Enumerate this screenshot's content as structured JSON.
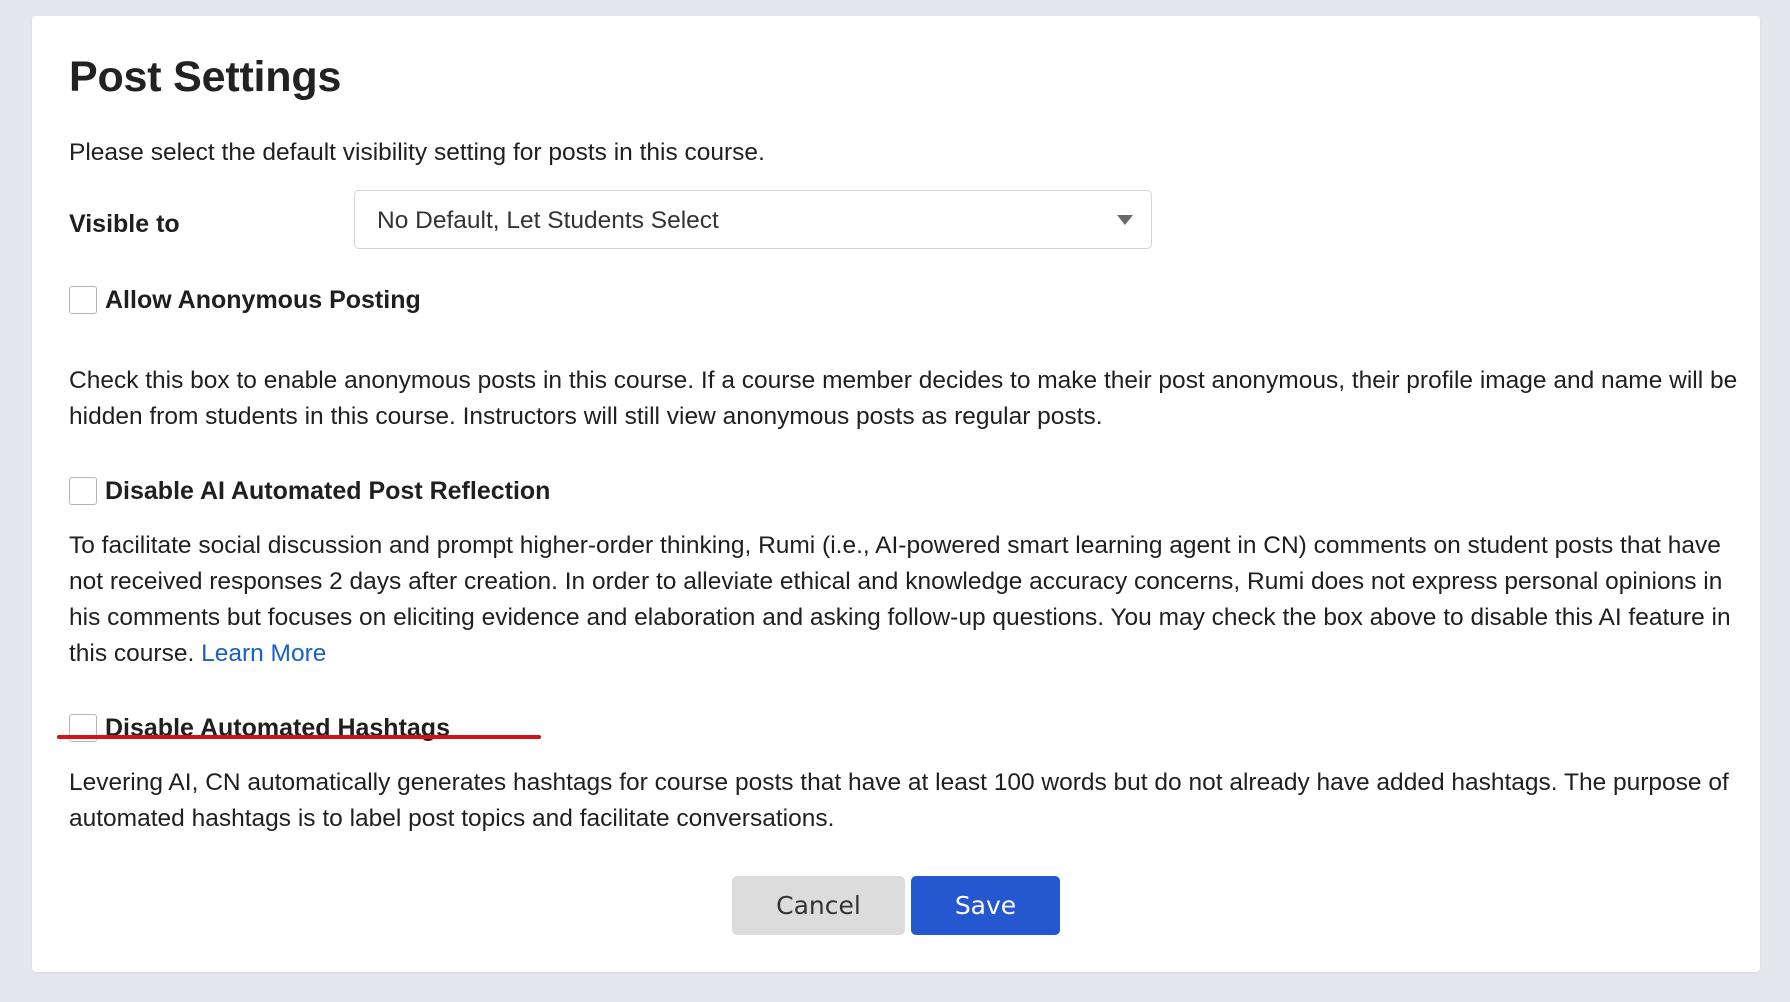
{
  "dialog": {
    "title": "Post Settings",
    "intro": "Please select the default visibility setting for posts in this course.",
    "visibility": {
      "label": "Visible to",
      "selected": "No Default, Let Students Select"
    },
    "options": [
      {
        "label": "Allow Anonymous Posting",
        "checked": false,
        "description": "Check this box to enable anonymous posts in this course. If a course member decides to make their post anonymous, their profile image and name will be hidden from students in this course. Instructors will still view anonymous posts as regular posts."
      },
      {
        "label": "Disable AI Automated Post Reflection",
        "checked": false,
        "description": "To facilitate social discussion and prompt higher-order thinking, Rumi (i.e., AI-powered smart learning agent in CN) comments on student posts that have not received responses 2 days after creation. In order to alleviate ethical and knowledge accuracy concerns, Rumi does not express personal opinions in his comments but focuses on eliciting evidence and elaboration and asking follow-up questions. You may check the box above to disable this AI feature in this course.",
        "link": "Learn More"
      },
      {
        "label": "Disable Automated Hashtags",
        "checked": false,
        "description": "Levering AI, CN automatically generates hashtags for course posts that have at least 100 words but do not already have added hashtags. The purpose of automated hashtags is to label post topics and facilitate conversations."
      }
    ],
    "buttons": {
      "cancel": "Cancel",
      "save": "Save"
    }
  },
  "colors": {
    "page_background": "#e4e7eb",
    "card_background": "#ffffff",
    "link": "#1a5fc9",
    "annotation_underline": "#d4101b",
    "save_button": "#2457d0",
    "cancel_button": "#dcdcdc"
  },
  "icons": {
    "select_caret": "caret-down-icon",
    "checkbox": "checkbox-unchecked"
  }
}
